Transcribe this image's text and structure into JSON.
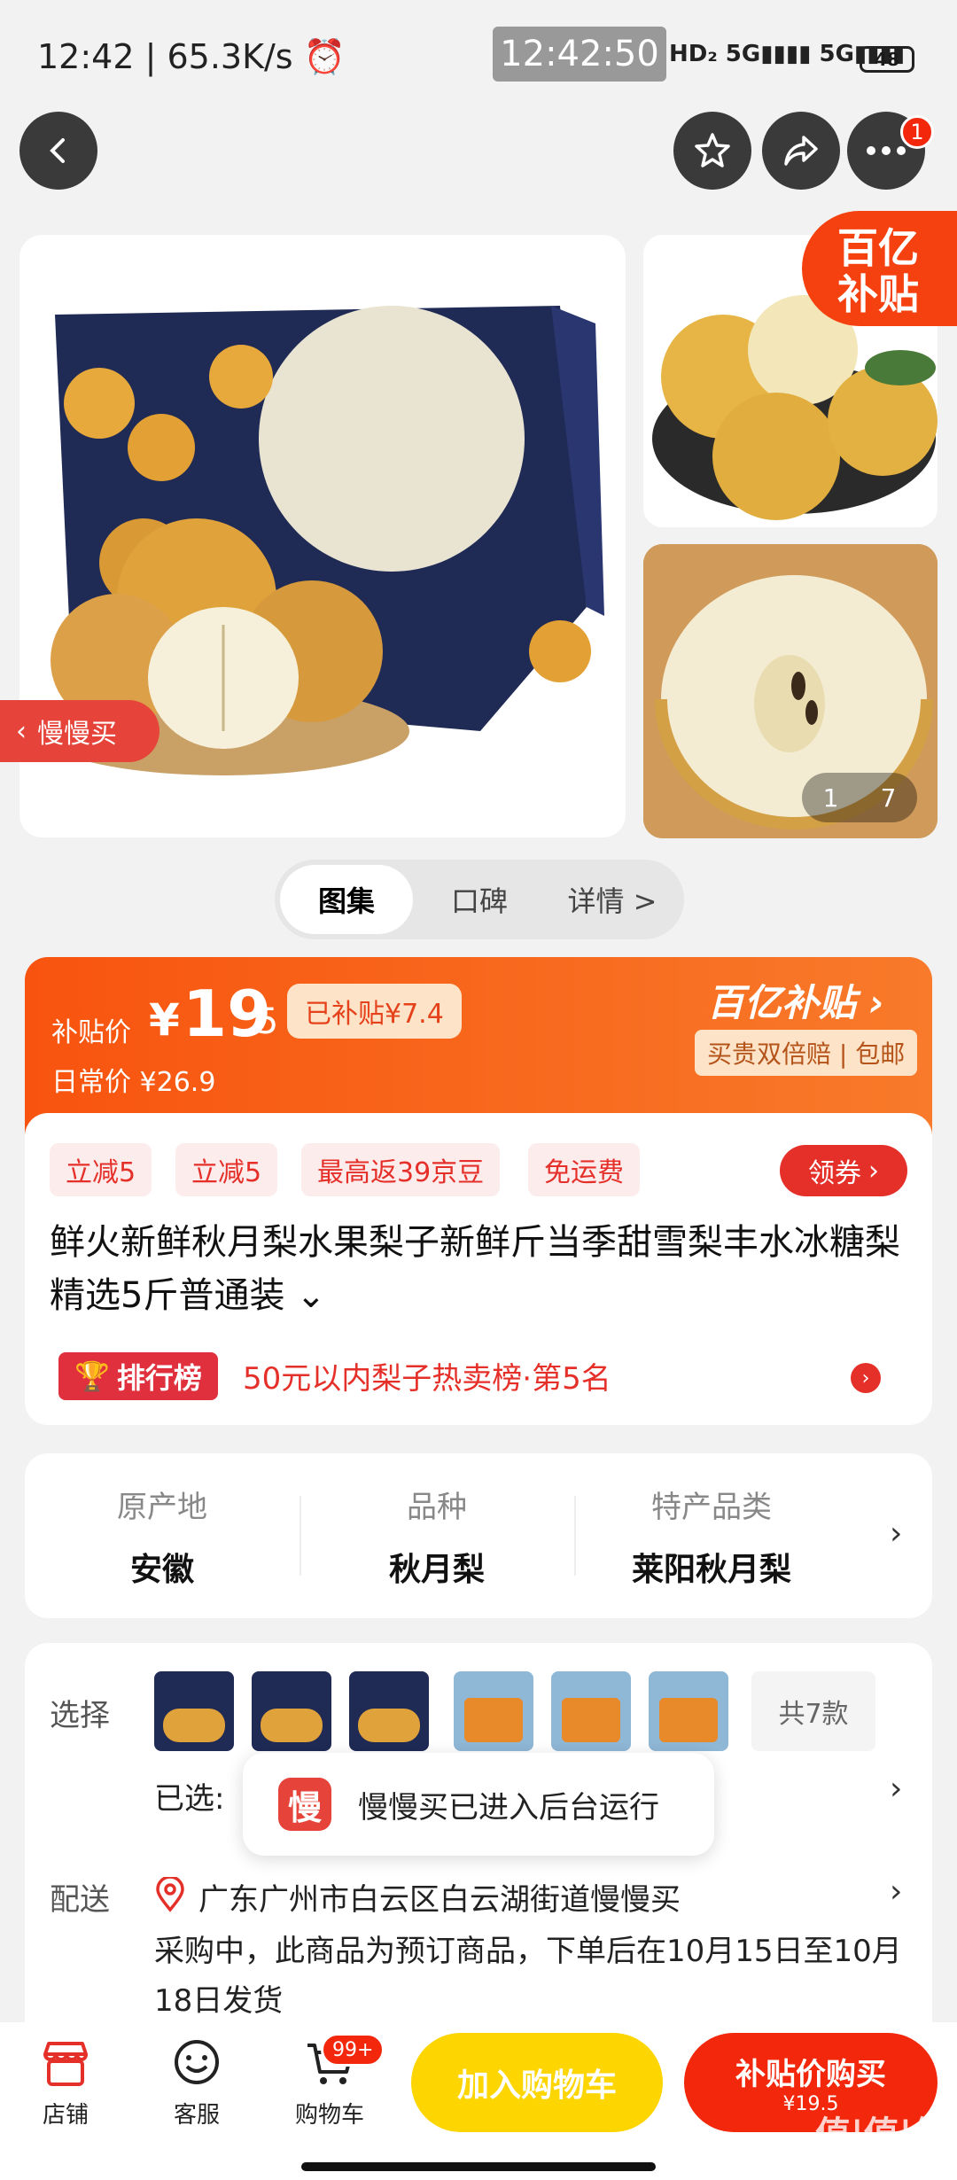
{
  "status": {
    "time": "12:42 | 65.3K/s ⏰",
    "clock": "12:42:50",
    "signal": "HD₂ 5G▮▮▮▮ 5G▮▮▮▮",
    "battery": "48"
  },
  "nav": {
    "more_badge": "1"
  },
  "gallery": {
    "subsidy_tag": "百亿补贴",
    "slow_buy": "慢慢买",
    "counter_current": "1",
    "counter_total": "7"
  },
  "tabs": [
    "图集",
    "口碑",
    "详情 >"
  ],
  "price": {
    "label": "补贴价",
    "yen": "¥",
    "integer": "19",
    "decimal": ".5",
    "subsidy_badge": "已补贴¥7.4",
    "daily_label": "日常价 ¥26.9",
    "brand": "百亿补贴 ›",
    "guarantee": "买贵双倍赔 | 包邮"
  },
  "promos": [
    "立减5",
    "立减5",
    "最高返39京豆",
    "免运费"
  ],
  "coupon_label": "领券",
  "product_title": "鲜火新鲜秋月梨水果梨子新鲜斤当季甜雪梨丰水冰糖梨 精选5斤普通装 ⌄",
  "rank": {
    "badge": "排行榜",
    "text": "50元以内梨子热卖榜·第5名"
  },
  "attributes": [
    {
      "key": "原产地",
      "value": "安徽"
    },
    {
      "key": "品种",
      "value": "秋月梨"
    },
    {
      "key": "特产品类",
      "value": "莱阳秋月梨"
    }
  ],
  "selection": {
    "label": "选择",
    "more": "共7款",
    "selected_label": "已选:"
  },
  "delivery": {
    "label": "配送",
    "address": "广东广州市白云区白云湖街道慢慢买",
    "note": "采购中，此商品为预订商品，下单后在10月15日至10月18日发货"
  },
  "toast": {
    "icon_char": "慢",
    "text": "慢慢买已进入后台运行"
  },
  "bottom": {
    "store": "店铺",
    "service": "客服",
    "cart": "购物车",
    "cart_badge": "99+",
    "add_to_cart": "加入购物车",
    "buy_now": "补贴价购买",
    "buy_price": "¥19.5"
  },
  "watermark": "值|值|值",
  "colors": {
    "accent": "#f2270c",
    "orange": "#f8540f",
    "yellow": "#fdd500"
  }
}
